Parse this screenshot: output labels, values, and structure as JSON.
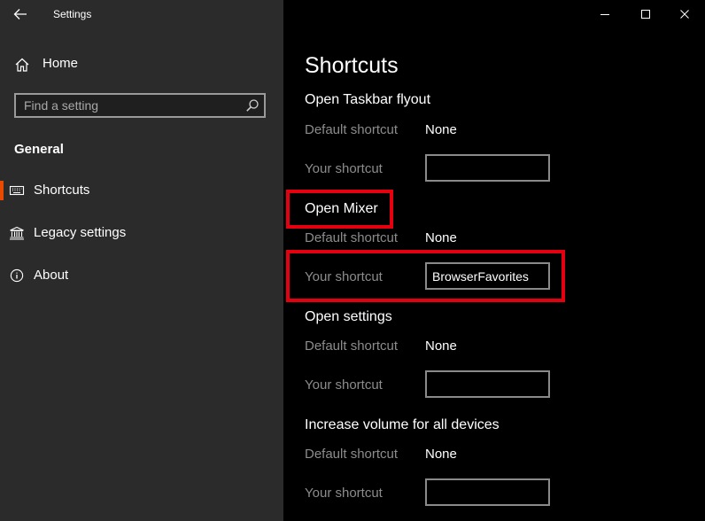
{
  "window": {
    "title": "Settings",
    "back_icon": "arrow-left-icon",
    "minimize_icon": "minimize-icon",
    "maximize_icon": "maximize-icon",
    "close_icon": "close-icon"
  },
  "sidebar": {
    "home_label": "Home",
    "search_placeholder": "Find a setting",
    "section_label": "General",
    "items": [
      {
        "label": "Shortcuts",
        "icon": "keyboard-icon",
        "selected": true
      },
      {
        "label": "Legacy settings",
        "icon": "bank-icon",
        "selected": false
      },
      {
        "label": "About",
        "icon": "info-icon",
        "selected": false
      }
    ]
  },
  "main": {
    "title": "Shortcuts",
    "groups": [
      {
        "title": "Open Taskbar flyout",
        "default_label": "Default shortcut",
        "default_value": "None",
        "your_label": "Your shortcut",
        "your_value": ""
      },
      {
        "title": "Open Mixer",
        "default_label": "Default shortcut",
        "default_value": "None",
        "your_label": "Your shortcut",
        "your_value": "BrowserFavorites"
      },
      {
        "title": "Open settings",
        "default_label": "Default shortcut",
        "default_value": "None",
        "your_label": "Your shortcut",
        "your_value": ""
      },
      {
        "title": "Increase volume for all devices",
        "default_label": "Default shortcut",
        "default_value": "None",
        "your_label": "Your shortcut",
        "your_value": ""
      }
    ]
  },
  "colors": {
    "sidebar_bg": "#2b2b2b",
    "main_bg": "#000000",
    "accent": "#e84a00",
    "highlight": "#e5000f"
  }
}
